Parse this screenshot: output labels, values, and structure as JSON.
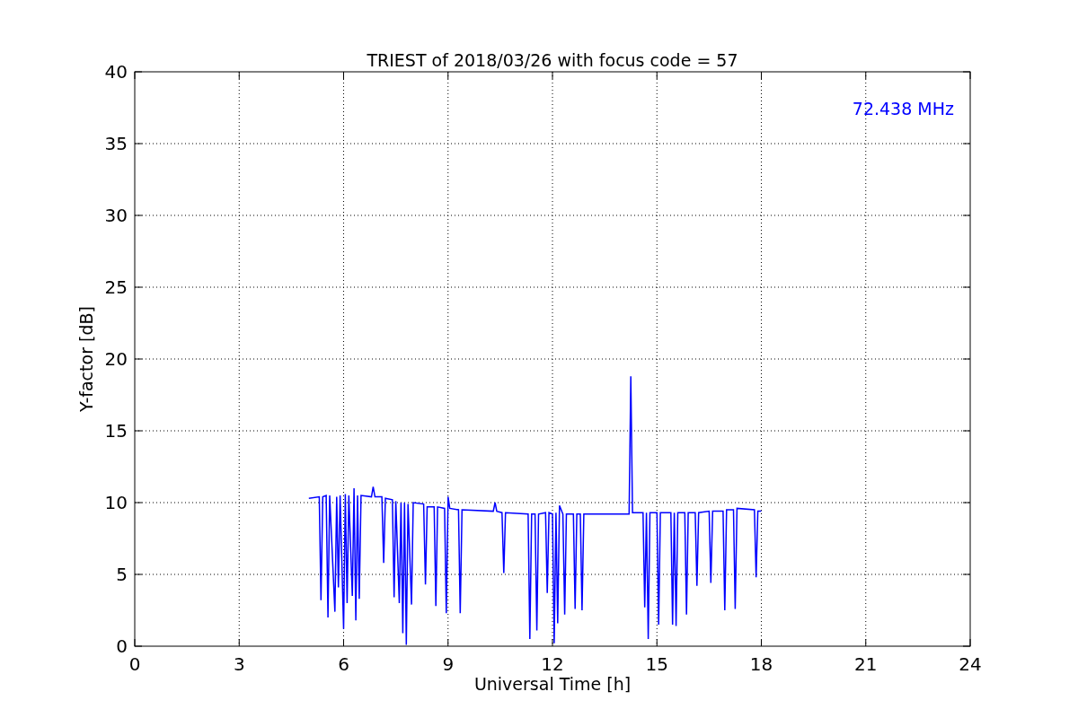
{
  "figure": {
    "chart_data": {
      "type": "line",
      "title": "TRIEST of 2018/03/26 with focus code = 57",
      "xlabel": "Universal Time [h]",
      "ylabel": "Y-factor [dB]",
      "x": [
        5.0,
        5.3,
        5.35,
        5.4,
        5.5,
        5.55,
        5.6,
        5.75,
        5.8,
        5.85,
        5.9,
        6.0,
        6.05,
        6.1,
        6.15,
        6.25,
        6.3,
        6.35,
        6.4,
        6.45,
        6.5,
        6.8,
        6.85,
        6.9,
        7.1,
        7.15,
        7.2,
        7.4,
        7.45,
        7.5,
        7.6,
        7.65,
        7.7,
        7.75,
        7.8,
        7.85,
        7.95,
        8.0,
        8.3,
        8.35,
        8.4,
        8.6,
        8.65,
        8.7,
        8.9,
        8.95,
        9.0,
        9.05,
        9.3,
        9.35,
        9.4,
        10.3,
        10.35,
        10.4,
        10.55,
        10.6,
        10.65,
        11.3,
        11.35,
        11.4,
        11.5,
        11.55,
        11.6,
        11.8,
        11.85,
        11.9,
        12.0,
        12.05,
        12.1,
        12.15,
        12.2,
        12.3,
        12.35,
        12.4,
        12.6,
        12.65,
        12.7,
        12.8,
        12.85,
        12.9,
        14.2,
        14.25,
        14.3,
        14.6,
        14.65,
        14.7,
        14.75,
        14.8,
        15.0,
        15.05,
        15.1,
        15.4,
        15.45,
        15.5,
        15.55,
        15.6,
        15.8,
        15.85,
        15.9,
        16.1,
        16.15,
        16.2,
        16.5,
        16.55,
        16.6,
        16.9,
        16.95,
        17.0,
        17.2,
        17.25,
        17.3,
        17.8,
        17.85,
        17.9,
        18.0
      ],
      "series": [
        {
          "name": "72.438 MHz",
          "color": "#0000ff",
          "values": [
            10.3,
            10.4,
            3.2,
            10.4,
            10.5,
            2.0,
            10.5,
            2.4,
            10.4,
            4.1,
            10.5,
            1.2,
            10.6,
            3.0,
            10.5,
            3.5,
            11.0,
            1.8,
            10.5,
            3.3,
            10.5,
            10.4,
            11.1,
            10.4,
            10.4,
            5.8,
            10.3,
            10.2,
            3.4,
            10.1,
            3.0,
            10.0,
            0.9,
            10.0,
            0.1,
            9.9,
            2.9,
            10.0,
            9.9,
            4.3,
            9.7,
            9.7,
            2.8,
            9.7,
            9.6,
            2.3,
            10.4,
            9.6,
            9.5,
            2.3,
            9.5,
            9.4,
            10.0,
            9.4,
            9.3,
            5.1,
            9.3,
            9.2,
            0.5,
            9.2,
            9.2,
            1.1,
            9.2,
            9.3,
            3.7,
            9.3,
            9.2,
            0.2,
            9.3,
            1.6,
            9.8,
            9.2,
            2.2,
            9.2,
            9.2,
            2.6,
            9.2,
            9.2,
            2.5,
            9.2,
            9.2,
            18.8,
            9.3,
            9.3,
            2.7,
            9.3,
            0.5,
            9.3,
            9.3,
            1.5,
            9.3,
            9.3,
            1.5,
            9.3,
            1.4,
            9.3,
            9.3,
            2.2,
            9.3,
            9.3,
            4.2,
            9.3,
            9.4,
            4.4,
            9.4,
            9.4,
            2.5,
            9.5,
            9.5,
            2.6,
            9.6,
            9.5,
            4.8,
            9.4,
            9.4
          ]
        }
      ],
      "xlim": [
        0,
        24
      ],
      "ylim": [
        0,
        40
      ],
      "xticks": [
        0,
        3,
        6,
        9,
        12,
        15,
        18,
        21,
        24
      ],
      "yticks": [
        0,
        5,
        10,
        15,
        20,
        25,
        30,
        35,
        40
      ],
      "grid": true
    }
  }
}
